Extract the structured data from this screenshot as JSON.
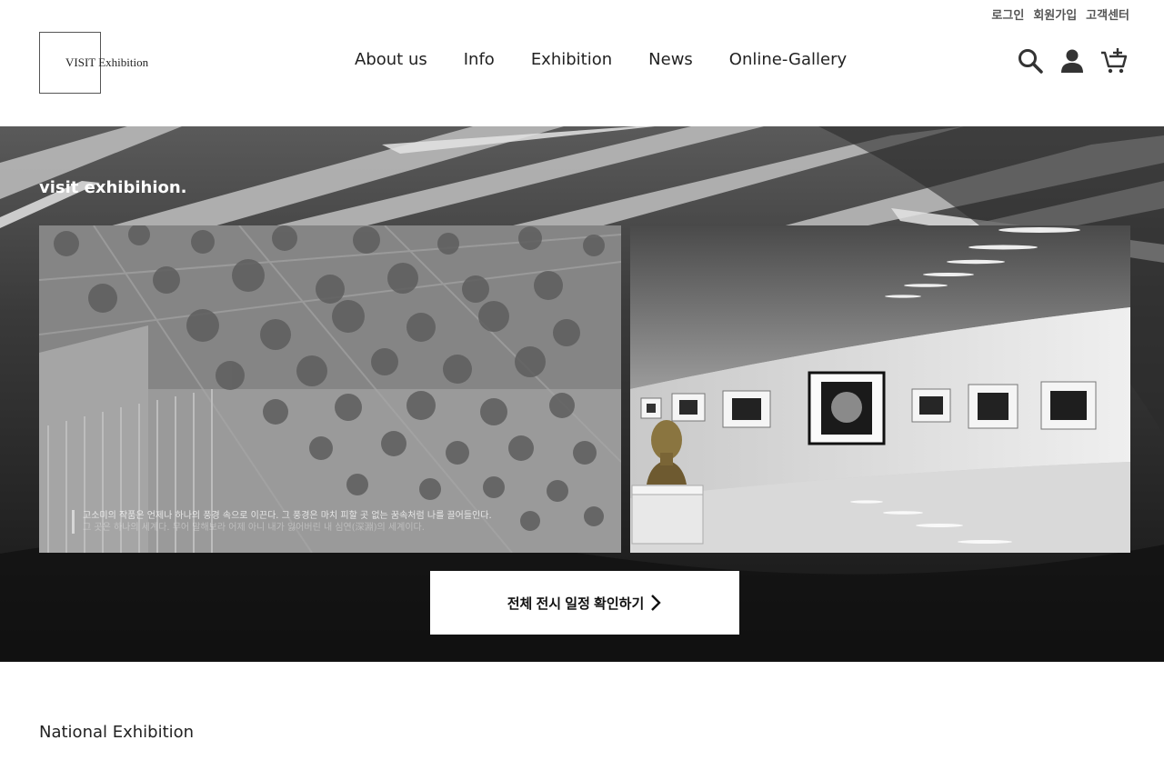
{
  "util_links": [
    "로그인",
    "회원가입",
    "고객센터"
  ],
  "logo": {
    "text": "VISIT Exhibition"
  },
  "nav": [
    "About us",
    "Info",
    "Exhibition",
    "News",
    "Online-Gallery"
  ],
  "icons": [
    "search-icon",
    "user-icon",
    "cart-icon"
  ],
  "hero": {
    "heading": "visit exhibihion.",
    "caption_line1": "고소미의 작품은 언제나 하나의 풍경 속으로 이끈다. 그 풍경은 마치 피할 곳 없는 꿈속처럼 나를 끌어들인다.",
    "caption_line2": "그 곳은 하나의 세계다. 무어 말해보라 어제 아니 내가 잃어버린 내 심연(深淵)의 세계이다.",
    "cta_label": "전체 전시 일정 확인하기"
  },
  "section": {
    "title": "National Exhibition"
  }
}
